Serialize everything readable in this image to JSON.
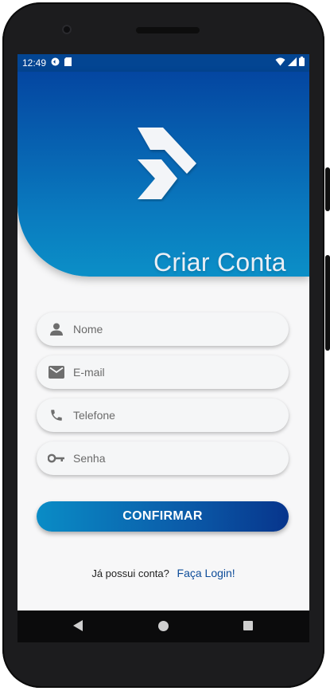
{
  "status_bar": {
    "time": "12:49"
  },
  "hero": {
    "title": "Criar Conta"
  },
  "form": {
    "name": {
      "placeholder": "Nome",
      "icon": "person-icon"
    },
    "email": {
      "placeholder": "E-mail",
      "icon": "mail-icon"
    },
    "phone": {
      "placeholder": "Telefone",
      "icon": "phone-icon"
    },
    "password": {
      "placeholder": "Senha",
      "icon": "key-icon"
    },
    "confirm_label": "CONFIRMAR"
  },
  "footer": {
    "question": "Já possui conta?",
    "login_link": "Faça Login!"
  },
  "colors": {
    "primary": "#0446a1",
    "accent": "#0b8fc7",
    "link": "#0d4c99"
  }
}
